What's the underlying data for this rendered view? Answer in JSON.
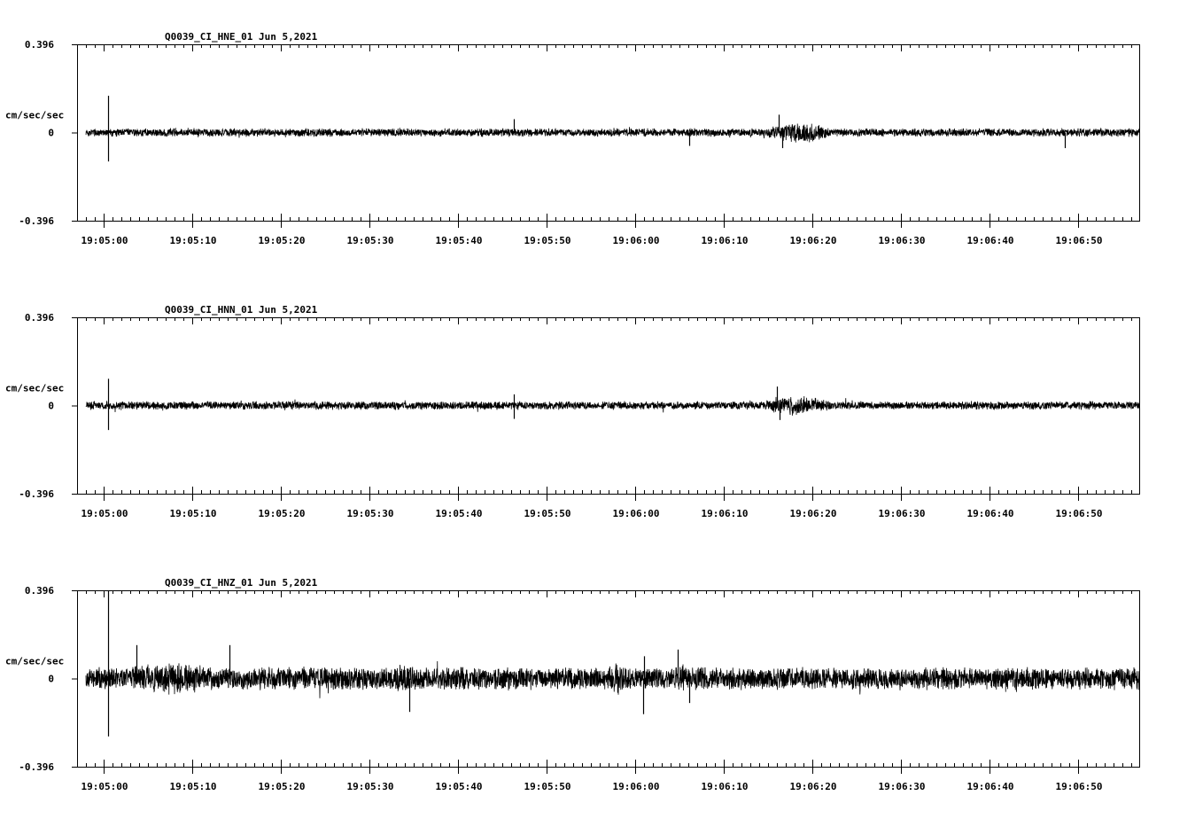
{
  "chart_data": [
    {
      "type": "line",
      "title": "Q0039_CI_HNE_01  Jun 5,2021",
      "ylabel": "cm/sec/sec",
      "ylim": [
        -0.396,
        0.396
      ],
      "yticks": [
        "0.396",
        "0",
        "-0.396"
      ],
      "xticks": [
        "19:05:00",
        "19:05:10",
        "19:05:20",
        "19:05:30",
        "19:05:40",
        "19:05:50",
        "19:06:00",
        "19:06:10",
        "19:06:20",
        "19:06:30",
        "19:06:40",
        "19:06:50"
      ],
      "xrange_seconds": [
        -2.9,
        117.0
      ],
      "noise_amplitude": 0.02,
      "spikes": [
        {
          "t": 0.5,
          "v": 0.165
        },
        {
          "t": 0.5,
          "v": -0.13
        },
        {
          "t": 46.3,
          "v": 0.06
        },
        {
          "t": 66.1,
          "v": -0.06
        },
        {
          "t": 76.2,
          "v": 0.08
        },
        {
          "t": 76.6,
          "v": -0.07
        },
        {
          "t": 108.5,
          "v": -0.07
        },
        {
          "t": 117.0,
          "v": 0.05
        }
      ],
      "bursts": [
        {
          "t0": 75.0,
          "t1": 82.0,
          "amp": 0.055
        }
      ]
    },
    {
      "type": "line",
      "title": "Q0039_CI_HNN_01  Jun 5,2021",
      "ylabel": "cm/sec/sec",
      "ylim": [
        -0.396,
        0.396
      ],
      "yticks": [
        "0.396",
        "0",
        "-0.396"
      ],
      "xticks": [
        "19:05:00",
        "19:05:10",
        "19:05:20",
        "19:05:30",
        "19:05:40",
        "19:05:50",
        "19:06:00",
        "19:06:10",
        "19:06:20",
        "19:06:30",
        "19:06:40",
        "19:06:50"
      ],
      "xrange_seconds": [
        -2.9,
        117.0
      ],
      "noise_amplitude": 0.02,
      "spikes": [
        {
          "t": 0.5,
          "v": 0.12
        },
        {
          "t": 0.5,
          "v": -0.11
        },
        {
          "t": 46.3,
          "v": 0.05
        },
        {
          "t": 46.3,
          "v": -0.06
        },
        {
          "t": 76.0,
          "v": 0.085
        },
        {
          "t": 76.3,
          "v": -0.065
        }
      ],
      "bursts": [
        {
          "t0": 74.5,
          "t1": 82.0,
          "amp": 0.05
        }
      ]
    },
    {
      "type": "line",
      "title": "Q0039_CI_HNZ_01  Jun 5,2021",
      "ylabel": "cm/sec/sec",
      "ylim": [
        -0.396,
        0.396
      ],
      "yticks": [
        "0.396",
        "0",
        "-0.396"
      ],
      "xticks": [
        "19:05:00",
        "19:05:10",
        "19:05:20",
        "19:05:30",
        "19:05:40",
        "19:05:50",
        "19:06:00",
        "19:06:10",
        "19:06:20",
        "19:06:30",
        "19:06:40",
        "19:06:50"
      ],
      "xrange_seconds": [
        -2.9,
        117.0
      ],
      "noise_amplitude": 0.055,
      "spikes": [
        {
          "t": 0.5,
          "v": 0.396
        },
        {
          "t": 0.5,
          "v": -0.26
        },
        {
          "t": 3.7,
          "v": 0.15
        },
        {
          "t": 14.2,
          "v": 0.15
        },
        {
          "t": 34.5,
          "v": -0.15
        },
        {
          "t": 60.9,
          "v": -0.16
        },
        {
          "t": 61.0,
          "v": 0.1
        },
        {
          "t": 64.8,
          "v": 0.13
        },
        {
          "t": 66.1,
          "v": -0.11
        },
        {
          "t": 117.0,
          "v": -0.12
        },
        {
          "t": 117.0,
          "v": 0.12
        }
      ],
      "bursts": [
        {
          "t0": 0.0,
          "t1": 15.0,
          "amp": 0.085
        },
        {
          "t0": 32.0,
          "t1": 36.0,
          "amp": 0.08
        },
        {
          "t0": 56.0,
          "t1": 60.0,
          "amp": 0.075
        },
        {
          "t0": 63.0,
          "t1": 67.0,
          "amp": 0.08
        }
      ]
    }
  ]
}
